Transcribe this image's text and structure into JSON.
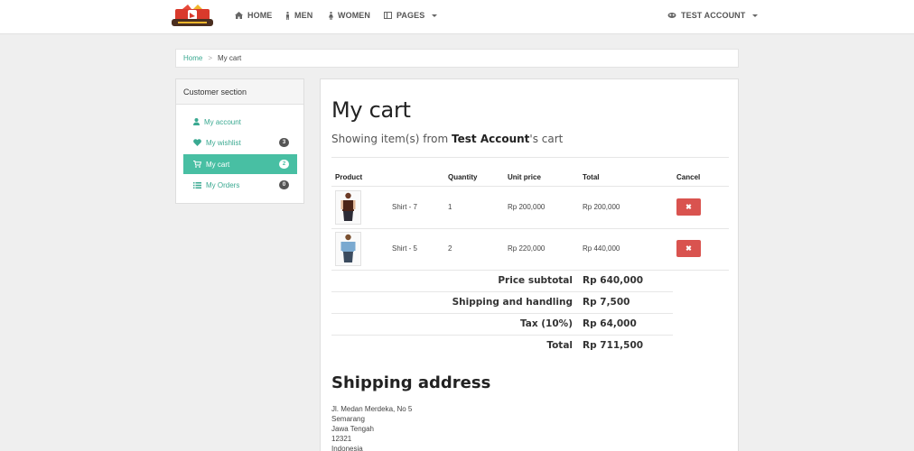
{
  "nav": {
    "logo_alt": "shop logo",
    "items": [
      {
        "label": "HOME",
        "icon": "home-icon"
      },
      {
        "label": "MEN",
        "icon": "male-icon"
      },
      {
        "label": "WOMEN",
        "icon": "female-icon"
      },
      {
        "label": "PAGES",
        "icon": "pages-icon"
      }
    ],
    "account_label": "TEST ACCOUNT"
  },
  "breadcrumb": {
    "home": "Home",
    "separator": ">",
    "current": "My cart"
  },
  "sidebar": {
    "title": "Customer section",
    "items": [
      {
        "label": "My account",
        "icon": "user-icon",
        "badge": ""
      },
      {
        "label": "My wishlist",
        "icon": "heart-icon",
        "badge": "3"
      },
      {
        "label": "My cart",
        "icon": "cart-icon",
        "badge": "2",
        "active": true
      },
      {
        "label": "My Orders",
        "icon": "list-icon",
        "badge": "0"
      }
    ]
  },
  "cart": {
    "title": "My cart",
    "subtitle_prefix": "Showing item(s) from ",
    "subtitle_user": "Test Account",
    "subtitle_suffix": "'s cart",
    "columns": [
      "Product",
      "Quantity",
      "Unit price",
      "Total",
      "Cancel"
    ],
    "rows": [
      {
        "name": "Shirt - 7",
        "quantity": "1",
        "unit_price": "Rp 200,000",
        "total": "Rp 200,000"
      },
      {
        "name": "Shirt - 5",
        "quantity": "2",
        "unit_price": "Rp 220,000",
        "total": "Rp 440,000"
      }
    ],
    "summary": [
      {
        "label": "Price subtotal",
        "value": "Rp 640,000"
      },
      {
        "label": "Shipping and handling",
        "value": "Rp 7,500"
      },
      {
        "label": "Tax (10%)",
        "value": "Rp 64,000"
      },
      {
        "label": "Total",
        "value": "Rp 711,500"
      }
    ]
  },
  "shipping": {
    "title": "Shipping address",
    "lines": [
      "Jl. Medan Merdeka, No 5",
      "Semarang",
      "Jawa Tengah",
      "12321",
      "Indonesia"
    ]
  },
  "colors": {
    "accent": "#48bfa3",
    "link": "#3aa991",
    "danger": "#d9534f"
  }
}
